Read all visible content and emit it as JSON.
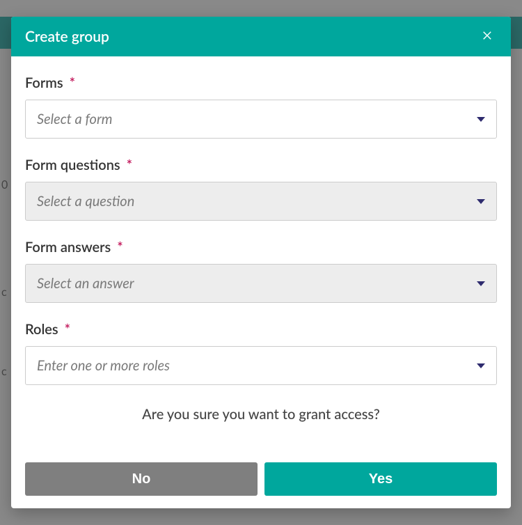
{
  "modal": {
    "title": "Create group",
    "fields": {
      "forms": {
        "label": "Forms",
        "required": "*",
        "placeholder": "Select a form",
        "disabled": false
      },
      "questions": {
        "label": "Form questions",
        "required": "*",
        "placeholder": "Select a question",
        "disabled": true
      },
      "answers": {
        "label": "Form answers",
        "required": "*",
        "placeholder": "Select an answer",
        "disabled": true
      },
      "roles": {
        "label": "Roles",
        "required": "*",
        "placeholder": "Enter one or more roles",
        "disabled": false
      }
    },
    "confirm_text": "Are you sure you want to grant access?",
    "buttons": {
      "no": "No",
      "yes": "Yes"
    }
  }
}
